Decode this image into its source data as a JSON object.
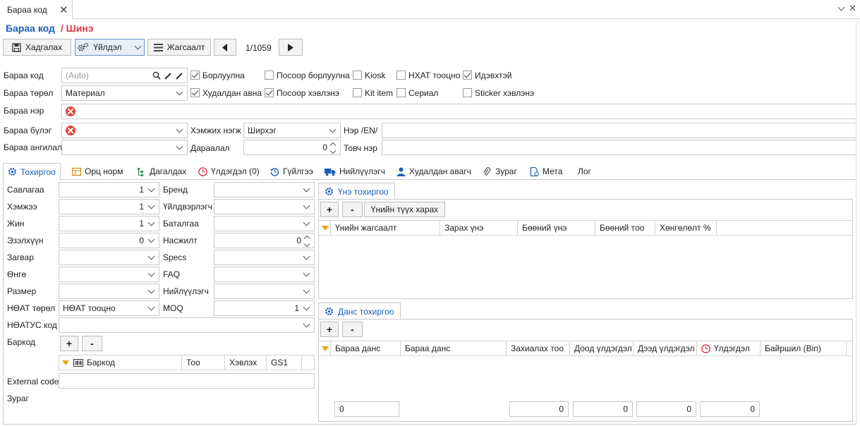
{
  "doc_tab": {
    "label": "Бараа код"
  },
  "title": {
    "main": "Бараа код",
    "sub": "/ Шинэ"
  },
  "toolbar": {
    "save": "Хадгалах",
    "action": "Үйлдэл",
    "list": "Жагсаалт",
    "pager": "1/1059"
  },
  "form": {
    "code_label": "Бараа код",
    "code_placeholder": "(Auto)",
    "type_label": "Бараа төрөл",
    "type_value": "Материал",
    "name_label": "Бараа нэр",
    "group_label": "Бараа бүлэг",
    "category_label": "Бараа ангилал",
    "unit_label": "Хэмжих нэгж",
    "unit_value": "Ширхэг",
    "order_label": "Дараалал",
    "order_value": "0",
    "name_en_label": "Нэр /EN/",
    "short_name_label": "Товч нэр"
  },
  "checks": [
    {
      "label": "Борлуулна",
      "checked": true
    },
    {
      "label": "Посоор борлуулна",
      "checked": false
    },
    {
      "label": "Kiosk",
      "checked": false
    },
    {
      "label": "НХАТ тооцно",
      "checked": false
    },
    {
      "label": "Идэвхтэй",
      "checked": true
    },
    {
      "label": "Худалдан авна",
      "checked": true
    },
    {
      "label": "Посоор хэвлэнэ",
      "checked": true
    },
    {
      "label": "Kit item",
      "checked": false
    },
    {
      "label": "Сериал",
      "checked": false
    },
    {
      "label": "Sticker хэвлэнэ",
      "checked": false
    }
  ],
  "tabs": [
    "Тохиргоо",
    "Орц норм",
    "Дагалдах",
    "Үлдэгдэл (0)",
    "Гүйлгээ",
    "Нийлүүлэгч",
    "Худалдан авагч",
    "Зураг",
    "Мета",
    "Лог"
  ],
  "settings": {
    "left": [
      {
        "label": "Савлагаа",
        "value": "1"
      },
      {
        "label": "Хэмжээ",
        "value": "1"
      },
      {
        "label": "Жин",
        "value": "1"
      },
      {
        "label": "Эзэлхүүн",
        "value": "0"
      },
      {
        "label": "Загвар",
        "value": ""
      },
      {
        "label": "Өнгө",
        "value": ""
      },
      {
        "label": "Размер",
        "value": ""
      },
      {
        "label": "НӨАТ төрөл",
        "value": "НӨАТ тооцно"
      }
    ],
    "right": [
      {
        "label": "Бренд",
        "value": ""
      },
      {
        "label": "Үйлдвэрлэгч",
        "value": ""
      },
      {
        "label": "Баталгаа",
        "value": ""
      },
      {
        "label": "Насжилт",
        "value": "0"
      },
      {
        "label": "Specs",
        "value": ""
      },
      {
        "label": "FAQ",
        "value": ""
      },
      {
        "label": "Нийлүүлэгч",
        "value": ""
      },
      {
        "label": "MOQ",
        "value": "1"
      }
    ],
    "vat_code_label": "НӨАТУС код",
    "barcode_label": "Баркод",
    "external_code_label": "External code",
    "image_label": "Зураг",
    "barcode_columns": [
      "Баркод",
      "Тоо",
      "Хэвлэх",
      "GS1"
    ]
  },
  "price_panel": {
    "tab": "Үнэ тохиргоо",
    "add": "+",
    "remove": "-",
    "history": "Үнийн түүх харах",
    "columns": [
      "Үнийн жагсаалт",
      "Зарах үнэ",
      "Бөөний үнэ",
      "Бөөний тоо",
      "Хөнгөлөлт %"
    ]
  },
  "account_panel": {
    "tab": "Данс тохиргоо",
    "add": "+",
    "remove": "-",
    "columns": [
      "Бараа данс",
      "Бараа данс",
      "Захиалах тоо",
      "Доод үлдэгдэл",
      "Дээд үлдэгдэл",
      "Үлдэгдэл",
      "Байршил (Bin)"
    ],
    "footer": [
      "0",
      "0",
      "0",
      "0",
      "0"
    ]
  },
  "colors": {
    "accent": "#1b5fb7",
    "danger": "#d83a4f",
    "filter": "#e8a414"
  }
}
